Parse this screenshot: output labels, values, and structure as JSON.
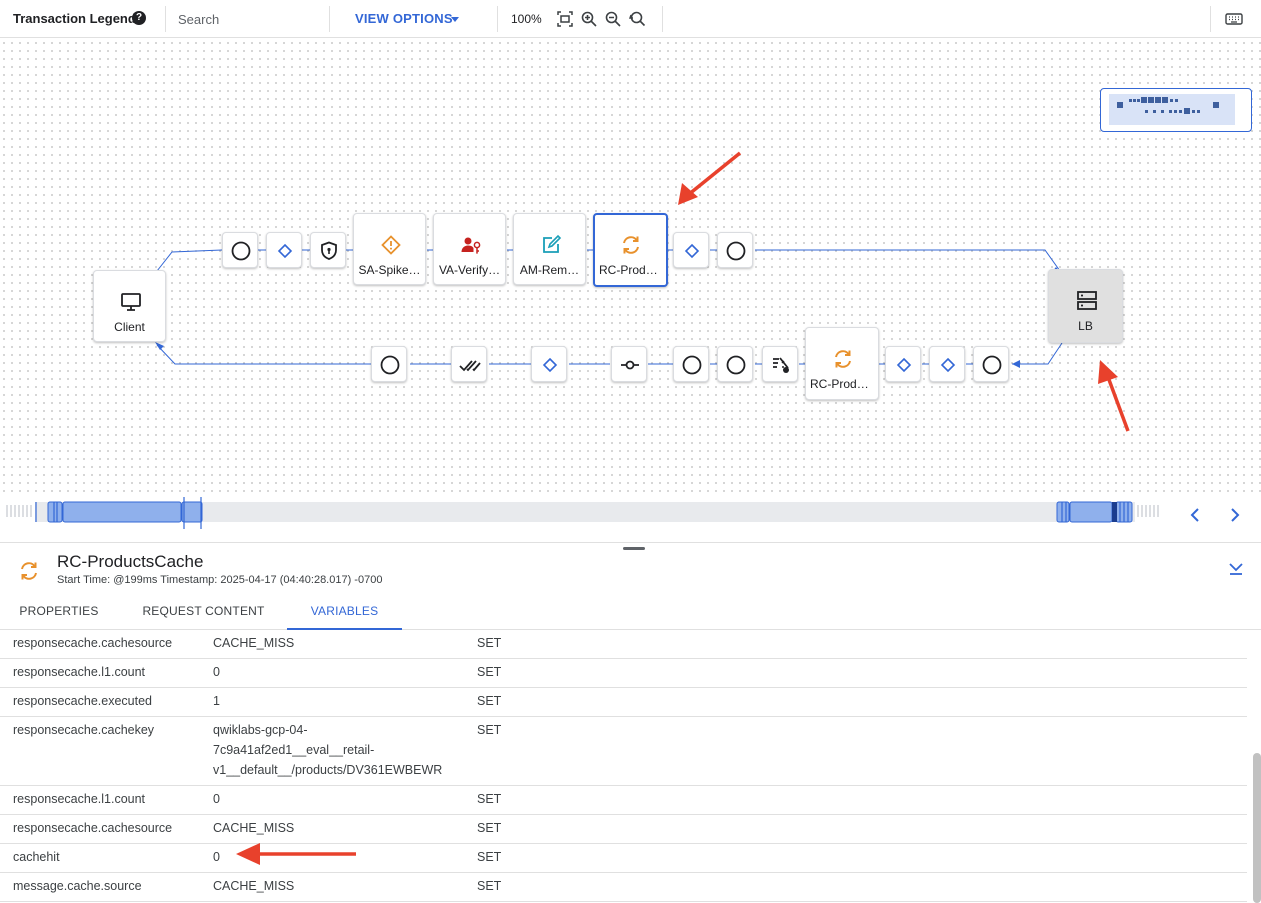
{
  "toolbar": {
    "title": "Transaction Legend",
    "search_placeholder": "Search",
    "view_options": "VIEW OPTIONS",
    "zoom": "100%"
  },
  "flow": {
    "client_label": "Client",
    "target_label": "LB",
    "request_nodes": [
      "SA-Spike…",
      "VA-Verify…",
      "AM-Rem…",
      "RC-Produ…"
    ],
    "response_nodes": [
      "RC-Produ…"
    ]
  },
  "detail": {
    "title": "RC-ProductsCache",
    "subtitle": "Start Time: @199ms Timestamp: 2025-04-17 (04:40:28.017) -0700",
    "tabs": [
      "PROPERTIES",
      "REQUEST CONTENT",
      "VARIABLES"
    ],
    "active_tab": "VARIABLES",
    "rows": [
      {
        "name": "responsecache.cachesource",
        "value": "CACHE_MISS",
        "op": "SET"
      },
      {
        "name": "responsecache.l1.count",
        "value": "0",
        "op": "SET"
      },
      {
        "name": "responsecache.executed",
        "value": "1",
        "op": "SET"
      },
      {
        "name": "responsecache.cachekey",
        "value": "qwiklabs-gcp-04-\n7c9a41af2ed1__eval__retail-\nv1__default__/products/DV361EWBEWR",
        "op": "SET"
      },
      {
        "name": "responsecache.l1.count",
        "value": "0",
        "op": "SET"
      },
      {
        "name": "responsecache.cachesource",
        "value": "CACHE_MISS",
        "op": "SET"
      },
      {
        "name": "cachehit",
        "value": "0",
        "op": "SET"
      },
      {
        "name": "message.cache.source",
        "value": "CACHE_MISS",
        "op": "SET"
      }
    ]
  },
  "colors": {
    "accent": "#3367d6",
    "cache_icon": "#e8912c",
    "spike_icon": "#e8912c",
    "verify_icon": "#c5221f",
    "assign_icon": "#1a9fb8",
    "annotation_arrow": "#e8412c"
  },
  "icons": [
    "help-icon",
    "fit-icon",
    "zoom-in-icon",
    "zoom-out-icon",
    "zoom-reset-icon",
    "keyboard-icon",
    "monitor-icon",
    "server-icon",
    "cache-icon",
    "warning-diamond-icon",
    "user-key-icon",
    "edit-icon",
    "shield-icon",
    "condition-diamond-icon",
    "circle-icon",
    "double-check-icon",
    "connector-icon",
    "extract-icon",
    "chevron-left-icon",
    "chevron-right-icon",
    "collapse-icon"
  ]
}
